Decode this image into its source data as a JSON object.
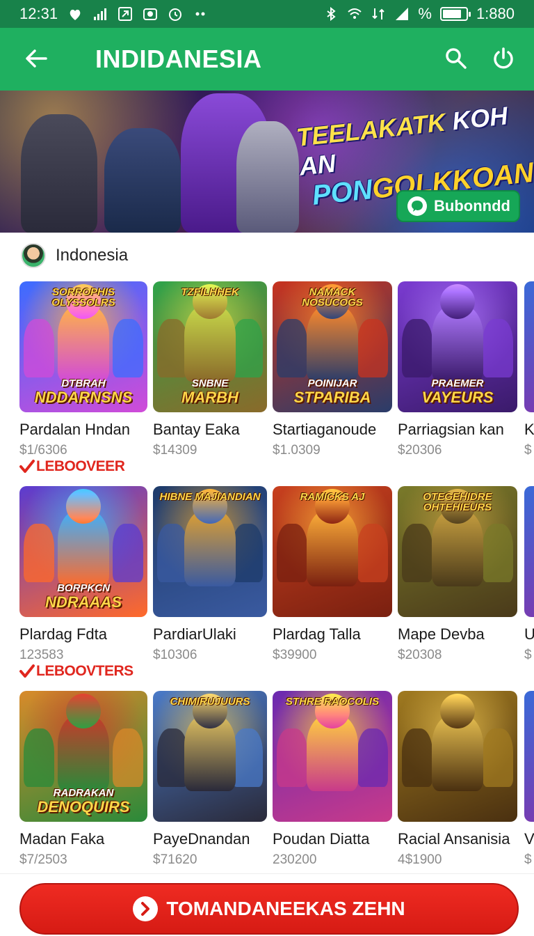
{
  "status_bar": {
    "time": "12:31",
    "right_time": "1:880",
    "battery_level": 0.8,
    "percent_symbol": "%"
  },
  "app_bar": {
    "title": "INDIDANESIA",
    "icons": [
      "back-arrow-icon",
      "search-icon",
      "power-icon"
    ]
  },
  "banner": {
    "headline_word1": "TEELAKATK",
    "headline_word2": "KOH AN",
    "headline_line2a": "PON",
    "headline_line2b": "GOLKKOAN",
    "button_label": "Bubonndd"
  },
  "region": {
    "label": "Indonesia"
  },
  "games": [
    {
      "title": "Pardalan Hndan",
      "price": "$1/6306",
      "art_top": "SORROPHIS OLYSSOLRS",
      "art_bottom": "NDDARNSNS",
      "art_small": "DTBRAH",
      "colors": [
        "#3b6cff",
        "#d14bd8",
        "#ffb347"
      ]
    },
    {
      "title": "Bantay Eaka",
      "price": "$14309",
      "art_top": "TZFILHHEK",
      "art_bottom": "MARBH",
      "art_small": "SNBNE",
      "colors": [
        "#2ea34a",
        "#8a6a2a",
        "#c7d94a"
      ]
    },
    {
      "title": "Startiaganoude",
      "price": "$1.0309",
      "art_top": "NAMACK NOSUCOGS",
      "art_bottom": "STPARIBA",
      "art_small": "POINIJAR",
      "colors": [
        "#c8331f",
        "#2a3c6a",
        "#ff8a2a"
      ]
    },
    {
      "title": "Parriagsian kan",
      "price": "$20306",
      "art_top": "",
      "art_bottom": "VAYEURS",
      "art_small": "PRAEMER",
      "colors": [
        "#7a3bd1",
        "#3a1a6a",
        "#b07aff"
      ]
    },
    {
      "title": "Plardag Fdta",
      "price": "123583",
      "art_top": "",
      "art_bottom": "NDRAAAS",
      "art_small": "BORPKCN",
      "colors": [
        "#5a3bd1",
        "#ff6a2a",
        "#3bb0ff"
      ]
    },
    {
      "title": "PardiarUlaki",
      "price": "$10306",
      "art_top": "HIBNE MAJIANDIAN",
      "art_bottom": "",
      "art_small": "",
      "colors": [
        "#1e3b6a",
        "#3a5aa0",
        "#e0a030"
      ]
    },
    {
      "title": "Plardag Talla",
      "price": "$39900",
      "art_top": "RAMICKS AJ",
      "art_bottom": "",
      "art_small": "",
      "colors": [
        "#c8401f",
        "#7a2010",
        "#ffb03a"
      ]
    },
    {
      "title": "Mape Devba",
      "price": "$20308",
      "art_top": "OTEGEHIDRE OHTEHIEURS",
      "art_bottom": "",
      "art_small": "",
      "colors": [
        "#7a7a2a",
        "#4a3a1a",
        "#c8a040"
      ]
    },
    {
      "title": "Madan Faka",
      "price": "$7/2503",
      "art_top": "",
      "art_bottom": "DENOQUIRS",
      "art_small": "RADRAKAN",
      "colors": [
        "#d88a2a",
        "#2a8a3a",
        "#c83a2a"
      ]
    },
    {
      "title": "PayeDnandan",
      "price": "$71620",
      "art_top": "CHIMIRUJUURS",
      "art_bottom": "",
      "art_small": "",
      "colors": [
        "#4a7ac8",
        "#2a2a3a",
        "#e0c060"
      ]
    },
    {
      "title": "Poudan Diatta",
      "price": "230200",
      "art_top": "STHRE RAOCOLIS",
      "art_bottom": "",
      "art_small": "",
      "colors": [
        "#6a2ab0",
        "#c83a8a",
        "#ffd040"
      ]
    },
    {
      "title": "Racial Ansanisia",
      "price": "4$1900",
      "art_top": "",
      "art_bottom": "",
      "art_small": "",
      "colors": [
        "#a07a20",
        "#4a3010",
        "#e8c050"
      ]
    }
  ],
  "partial_column": [
    {
      "title": "K",
      "price": "$"
    },
    {
      "title": "U",
      "price": "$"
    },
    {
      "title": "V",
      "price": "$"
    }
  ],
  "tags": [
    {
      "label": "LEBOOVEER"
    },
    {
      "label": "LEBOOVTERS"
    }
  ],
  "cta": {
    "label": "TOMANDANEEKAS ZEHN"
  }
}
